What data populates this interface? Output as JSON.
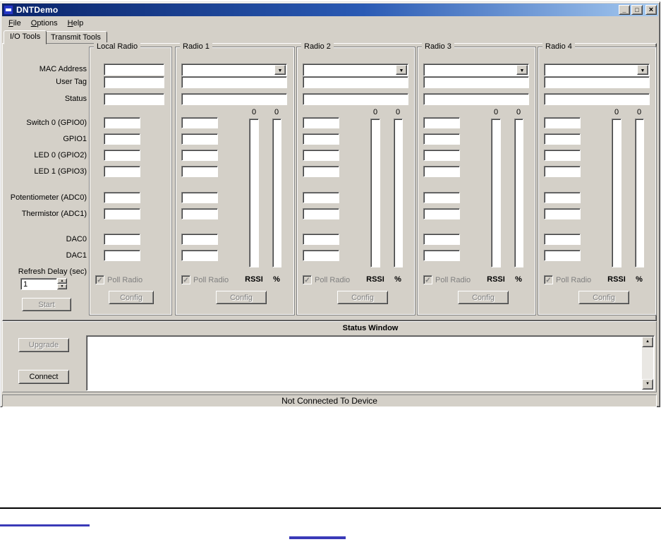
{
  "window": {
    "title": "DNTDemo",
    "buttons": {
      "minimize": "_",
      "maximize": "□",
      "close": "×"
    }
  },
  "menu": {
    "items": [
      "File",
      "Options",
      "Help"
    ]
  },
  "tabs": {
    "io": "I/O Tools",
    "transmit": "Transmit Tools"
  },
  "field_labels": {
    "mac": "MAC Address",
    "user_tag": "User Tag",
    "status": "Status",
    "switch0": "Switch 0 (GPIO0)",
    "gpio1": "GPIO1",
    "led0": "LED 0 (GPIO2)",
    "led1": "LED 1 (GPIO3)",
    "potentiometer": "Potentiometer (ADC0)",
    "thermistor": "Thermistor (ADC1)",
    "dac0": "DAC0",
    "dac1": "DAC1",
    "refresh_delay": "Refresh Delay (sec)"
  },
  "controls": {
    "refresh_value": "1",
    "start": "Start",
    "upgrade": "Upgrade",
    "connect": "Connect",
    "config": "Config",
    "poll_radio": "Poll Radio",
    "rssi": "RSSI",
    "percent": "%",
    "bar_value": "0"
  },
  "panels": [
    {
      "title": "Local Radio"
    },
    {
      "title": "Radio 1"
    },
    {
      "title": "Radio 2"
    },
    {
      "title": "Radio 3"
    },
    {
      "title": "Radio 4"
    }
  ],
  "status_window": {
    "title": "Status Window",
    "content": ""
  },
  "statusbar": {
    "text": "Not Connected To Device"
  },
  "glyphs": {
    "combo_arrow": "▼",
    "up": "▲",
    "down": "▼",
    "check": "✓"
  }
}
